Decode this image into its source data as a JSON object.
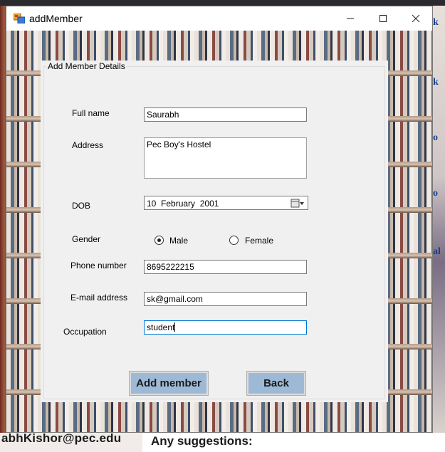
{
  "window": {
    "title": "addMember",
    "minimize_glyph": "—",
    "maximize_glyph": "☐",
    "close_glyph": "✕"
  },
  "background": {
    "email_text": "abhKishor@pec.edu",
    "suggestions_text": "Any suggestions:",
    "edge_letters": [
      "k",
      "k",
      "o",
      "o",
      "al"
    ]
  },
  "form": {
    "group_title": "Add Member Details",
    "fields": {
      "full_name": {
        "label": "Full name",
        "value": "Saurabh"
      },
      "address": {
        "label": "Address",
        "value": "Pec Boy's Hostel"
      },
      "dob": {
        "label": "DOB",
        "day": "10",
        "month": "February",
        "year": "2001"
      },
      "gender": {
        "label": "Gender",
        "options": [
          "Male",
          "Female"
        ],
        "selected": "Male"
      },
      "phone": {
        "label": "Phone number",
        "value": "8695222215"
      },
      "email": {
        "label": "E-mail address",
        "value": "sk@gmail.com"
      },
      "occupation": {
        "label": "Occupation",
        "value": "student"
      }
    },
    "buttons": {
      "add_member": "Add member",
      "back": "Back"
    }
  },
  "colors": {
    "button_bg": "#9db9d6",
    "focus_border": "#0078d7",
    "group_bg": "#f0f0f0"
  }
}
